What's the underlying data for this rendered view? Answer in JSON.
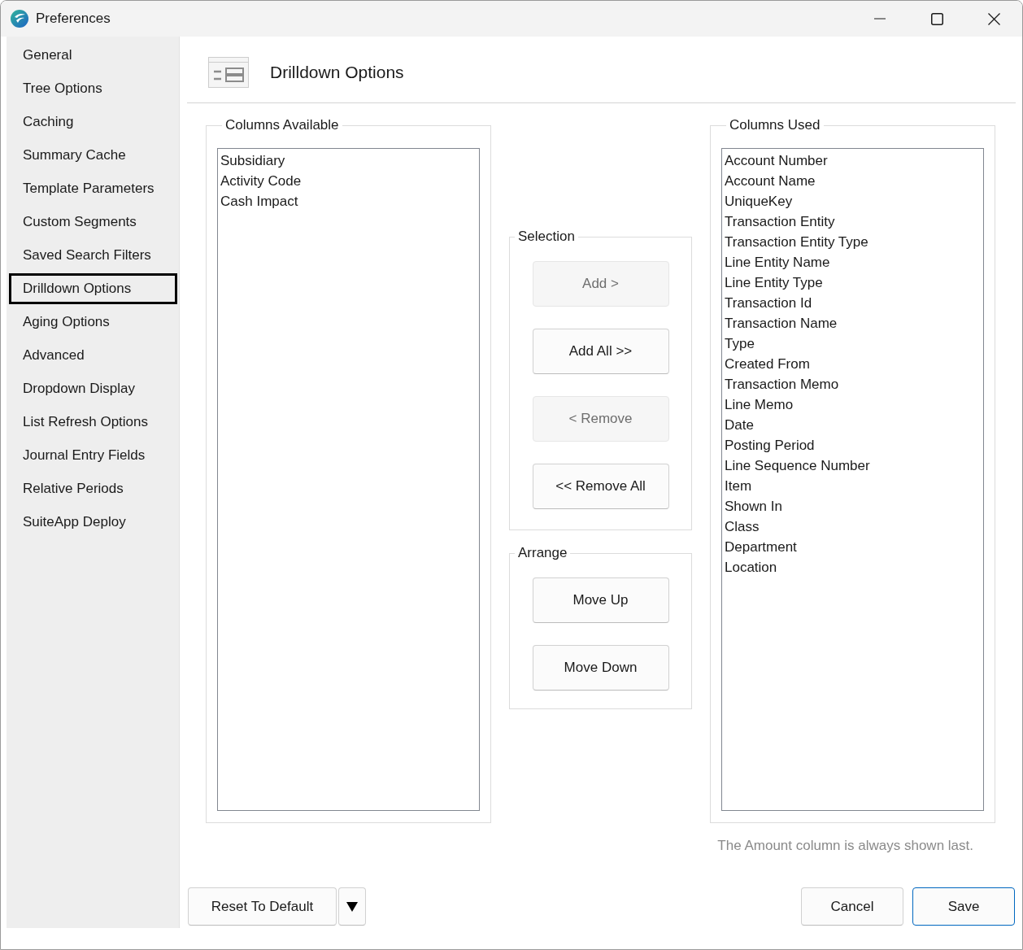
{
  "window": {
    "title": "Preferences"
  },
  "sidebar": {
    "items": [
      {
        "label": "General",
        "selected": false
      },
      {
        "label": "Tree Options",
        "selected": false
      },
      {
        "label": "Caching",
        "selected": false
      },
      {
        "label": "Summary Cache",
        "selected": false
      },
      {
        "label": "Template Parameters",
        "selected": false
      },
      {
        "label": "Custom Segments",
        "selected": false
      },
      {
        "label": "Saved Search Filters",
        "selected": false
      },
      {
        "label": "Drilldown Options",
        "selected": true
      },
      {
        "label": "Aging Options",
        "selected": false
      },
      {
        "label": "Advanced",
        "selected": false
      },
      {
        "label": "Dropdown Display",
        "selected": false
      },
      {
        "label": "List Refresh Options",
        "selected": false
      },
      {
        "label": "Journal Entry Fields",
        "selected": false
      },
      {
        "label": "Relative Periods",
        "selected": false
      },
      {
        "label": "SuiteApp Deploy",
        "selected": false
      }
    ]
  },
  "header": {
    "title": "Drilldown Options"
  },
  "columns_available": {
    "label": "Columns Available",
    "items": [
      "Subsidiary",
      "Activity Code",
      "Cash Impact"
    ]
  },
  "selection": {
    "label": "Selection",
    "buttons": [
      {
        "label": "Add >",
        "disabled": true
      },
      {
        "label": "Add All >>",
        "disabled": false
      },
      {
        "label": "< Remove",
        "disabled": true
      },
      {
        "label": "<< Remove All",
        "disabled": false
      }
    ]
  },
  "arrange": {
    "label": "Arrange",
    "buttons": [
      {
        "label": "Move Up",
        "disabled": false
      },
      {
        "label": "Move Down",
        "disabled": false
      }
    ]
  },
  "columns_used": {
    "label": "Columns Used",
    "items": [
      "Account Number",
      "Account Name",
      "UniqueKey",
      "Transaction Entity",
      "Transaction Entity Type",
      "Line Entity Name",
      "Line Entity Type",
      "Transaction Id",
      "Transaction Name",
      "Type",
      "Created From",
      "Transaction Memo",
      "Line Memo",
      "Date",
      "Posting Period",
      "Line Sequence Number",
      "Item",
      "Shown In",
      "Class",
      "Department",
      "Location"
    ]
  },
  "note": "The Amount column is always shown last.",
  "footer": {
    "reset_button": "Reset To Default",
    "buttons": [
      {
        "label": "Cancel",
        "default": false
      },
      {
        "label": "Save",
        "default": true
      }
    ]
  }
}
